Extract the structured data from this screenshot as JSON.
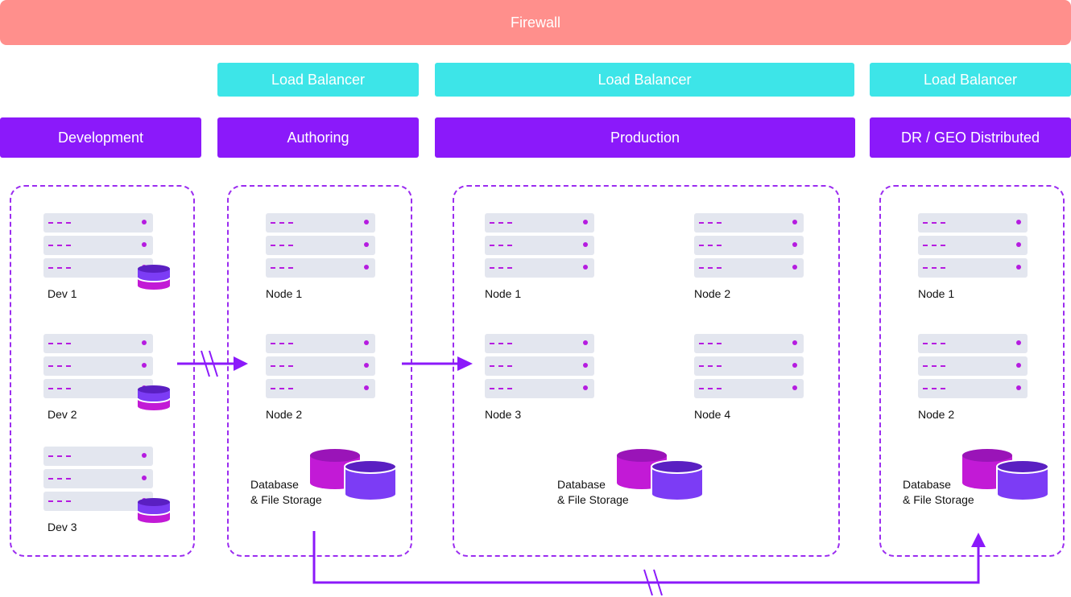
{
  "firewall": {
    "label": "Firewall"
  },
  "load_balancers": [
    {
      "label": "Load Balancer"
    },
    {
      "label": "Load Balancer"
    },
    {
      "label": "Load Balancer"
    }
  ],
  "environments": [
    {
      "label": "Development"
    },
    {
      "label": "Authoring"
    },
    {
      "label": "Production"
    },
    {
      "label": "DR / GEO Distributed"
    }
  ],
  "development": {
    "servers": [
      "Dev 1",
      "Dev 2",
      "Dev 3"
    ]
  },
  "authoring": {
    "nodes": [
      "Node 1",
      "Node 2"
    ],
    "storage_line1": "Database",
    "storage_line2": "& File Storage"
  },
  "production": {
    "nodes": [
      "Node 1",
      "Node 2",
      "Node 3",
      "Node 4"
    ],
    "storage_line1": "Database",
    "storage_line2": "& File Storage"
  },
  "dr": {
    "nodes": [
      "Node 1",
      "Node 2"
    ],
    "storage_line1": "Database",
    "storage_line2": "& File Storage"
  },
  "colors": {
    "firewall": "#ff8f8c",
    "load_balancer": "#3de5e8",
    "environment": "#8b19fa",
    "arrow": "#8b19fa",
    "db_magenta": "#c21ad6",
    "db_purple": "#7c3cf5"
  }
}
